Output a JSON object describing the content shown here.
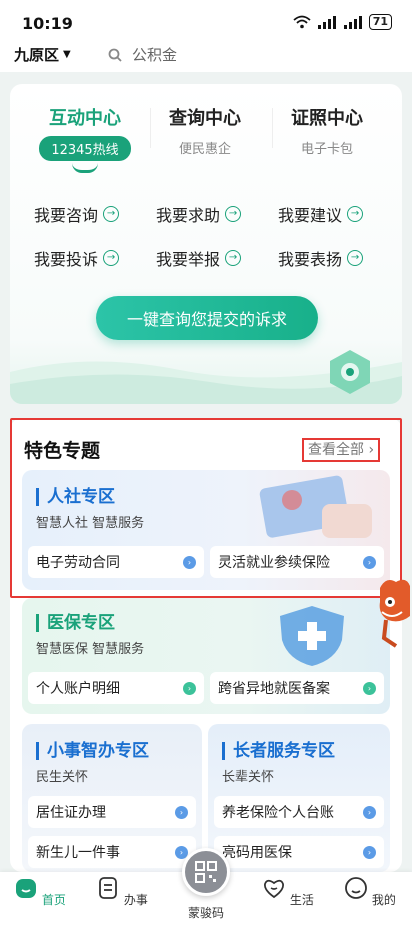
{
  "status_bar": {
    "time": "10:19",
    "battery": "71"
  },
  "top_bar": {
    "district": "九原区",
    "search_placeholder": "公积金"
  },
  "main_card": {
    "tabs": [
      {
        "title": "互动中心",
        "badge": "12345热线"
      },
      {
        "title": "查询中心",
        "sub": "便民惠企"
      },
      {
        "title": "证照中心",
        "sub": "电子卡包"
      }
    ],
    "actions": [
      "我要咨询",
      "我要求助",
      "我要建议",
      "我要投诉",
      "我要举报",
      "我要表扬"
    ],
    "cta": "一键查询您提交的诉求"
  },
  "featured": {
    "title": "特色专题",
    "view_all": "查看全部",
    "zones": [
      {
        "title": "人社专区",
        "sub": "智慧人社 智慧服务",
        "items": [
          "电子劳动合同",
          "灵活就业参续保险"
        ]
      },
      {
        "title": "医保专区",
        "sub": "智慧医保 智慧服务",
        "items": [
          "个人账户明细",
          "跨省异地就医备案"
        ]
      },
      {
        "title": "小事智办专区",
        "sub": "民生关怀",
        "items": [
          "居住证办理",
          "新生儿一件事"
        ]
      },
      {
        "title": "长者服务专区",
        "sub": "长辈关怀",
        "items": [
          "养老保险个人台账",
          "亮码用医保"
        ]
      }
    ]
  },
  "nav": {
    "home": "首页",
    "tasks": "办事",
    "qr": "蒙骏码",
    "life": "生活",
    "mine": "我的"
  },
  "colors": {
    "accent": "#1aa27a",
    "zone_blue": "#1a6fd0",
    "highlight": "#e53935"
  }
}
